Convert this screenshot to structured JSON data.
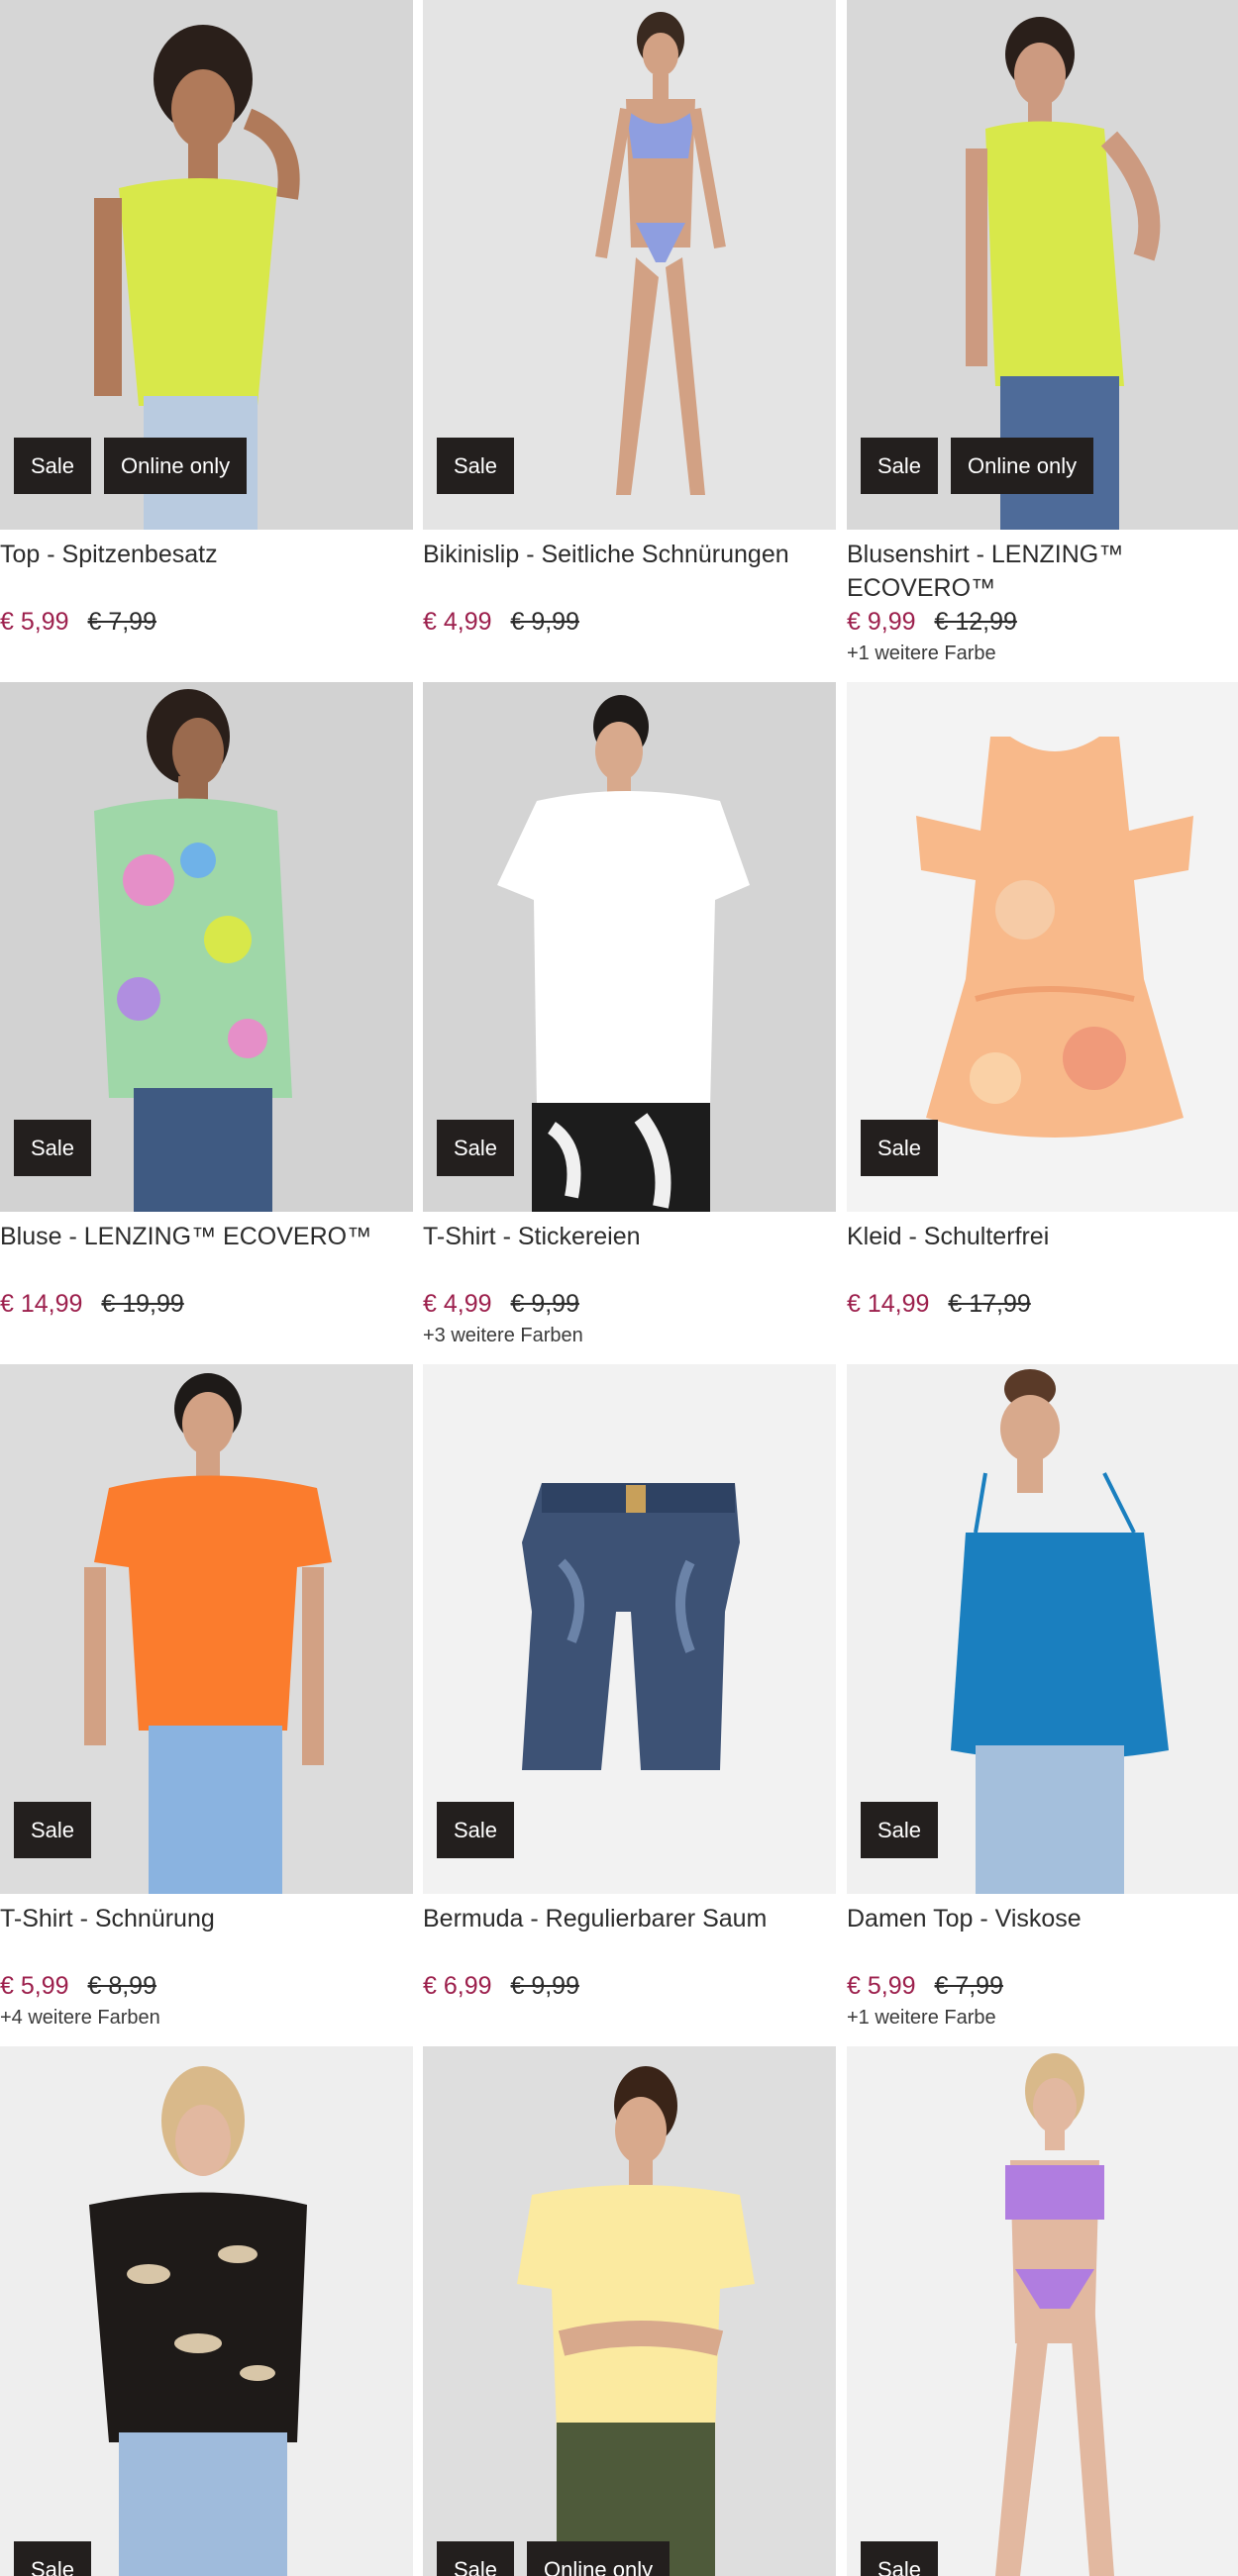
{
  "products": [
    {
      "title": "Top - Spitzenbesatz",
      "price": "€ 5,99",
      "old_price": "€ 7,99",
      "badges": [
        "Sale",
        "Online only"
      ],
      "more_colors": ""
    },
    {
      "title": "Bikinislip - Seitliche Schnürungen",
      "price": "€ 4,99",
      "old_price": "€ 9,99",
      "badges": [
        "Sale"
      ],
      "more_colors": ""
    },
    {
      "title": "Blusenshirt - LENZING™ ECOVERO™",
      "price": "€ 9,99",
      "old_price": "€ 12,99",
      "badges": [
        "Sale",
        "Online only"
      ],
      "more_colors": "+1 weitere Farbe"
    },
    {
      "title": "Bluse - LENZING™ ECOVERO™",
      "price": "€ 14,99",
      "old_price": "€ 19,99",
      "badges": [
        "Sale"
      ],
      "more_colors": ""
    },
    {
      "title": "T-Shirt - Stickereien",
      "price": "€ 4,99",
      "old_price": "€ 9,99",
      "badges": [
        "Sale"
      ],
      "more_colors": "+3 weitere Farben"
    },
    {
      "title": "Kleid - Schulterfrei",
      "price": "€ 14,99",
      "old_price": "€ 17,99",
      "badges": [
        "Sale"
      ],
      "more_colors": ""
    },
    {
      "title": "T-Shirt - Schnürung",
      "price": "€ 5,99",
      "old_price": "€ 8,99",
      "badges": [
        "Sale"
      ],
      "more_colors": "+4 weitere Farben"
    },
    {
      "title": "Bermuda - Regulierbarer Saum",
      "price": "€ 6,99",
      "old_price": "€ 9,99",
      "badges": [
        "Sale"
      ],
      "more_colors": ""
    },
    {
      "title": "Damen Top - Viskose",
      "price": "€ 5,99",
      "old_price": "€ 7,99",
      "badges": [
        "Sale"
      ],
      "more_colors": "+1 weitere Farbe"
    },
    {
      "title": "",
      "price": "",
      "old_price": "",
      "badges": [
        "Sale"
      ],
      "more_colors": ""
    },
    {
      "title": "",
      "price": "",
      "old_price": "",
      "badges": [
        "Sale",
        "Online only"
      ],
      "more_colors": ""
    },
    {
      "title": "",
      "price": "",
      "old_price": "",
      "badges": [
        "Sale"
      ],
      "more_colors": ""
    }
  ],
  "colors": {
    "sale_price": "#9c1f4c",
    "badge_bg": "#231f1e",
    "badge_text": "#ffffff"
  }
}
